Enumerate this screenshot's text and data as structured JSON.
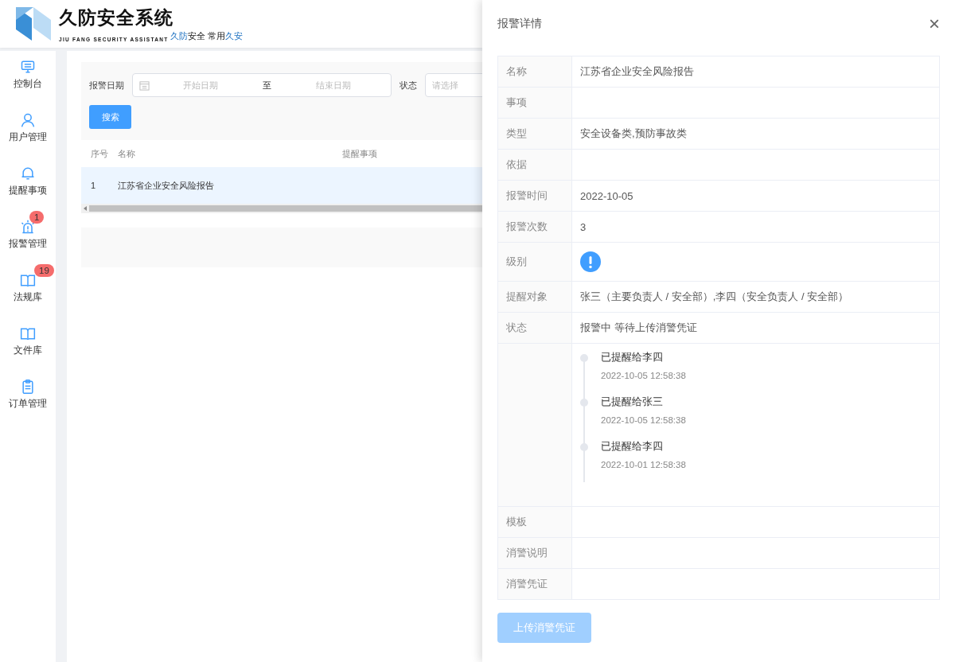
{
  "brand": {
    "title": "久防安全系统",
    "subtitle": "JIU FANG SECURITY ASSISTANT",
    "slogan": [
      {
        "text": "久防",
        "accent": true
      },
      {
        "text": "安全 ",
        "accent": false
      },
      {
        "text": "常用",
        "accent": false
      },
      {
        "text": "久安",
        "accent": true
      }
    ]
  },
  "sidebar": {
    "items": [
      {
        "label": "控制台"
      },
      {
        "label": "用户管理"
      },
      {
        "label": "提醒事项"
      },
      {
        "label": "报警管理",
        "badge": "1"
      },
      {
        "label": "法规库",
        "badge": "19"
      },
      {
        "label": "文件库"
      },
      {
        "label": "订单管理"
      }
    ]
  },
  "filters": {
    "date_label": "报警日期",
    "start_placeholder": "开始日期",
    "separator": "至",
    "end_placeholder": "结束日期",
    "status_label": "状态",
    "status_placeholder": "请选择",
    "search_button": "搜索"
  },
  "table": {
    "columns": [
      "序号",
      "名称",
      "提醒事项"
    ],
    "rows": [
      {
        "cells": [
          "1",
          "江苏省企业安全风险报告"
        ],
        "selected": true
      }
    ]
  },
  "drawer": {
    "title": "报警详情",
    "close": "×",
    "rows": [
      {
        "kind": "text",
        "label": "名称",
        "value": "江苏省企业安全风险报告"
      },
      {
        "kind": "text",
        "label": "事项"
      },
      {
        "kind": "text",
        "label": "类型",
        "value": "安全设备类,预防事故类"
      },
      {
        "kind": "text",
        "label": "依据"
      },
      {
        "kind": "text",
        "label": "报警时间",
        "value": "2022-10-05"
      },
      {
        "kind": "text",
        "label": "报警次数",
        "value": "3"
      },
      {
        "kind": "icon",
        "label": "级别"
      },
      {
        "kind": "text",
        "label": "提醒对象",
        "value": "张三（主要负责人 / 安全部）,李四（安全负责人 / 安全部）"
      },
      {
        "kind": "text",
        "label": "状态",
        "value": "报警中 等待上传消警凭证"
      },
      {
        "kind": "timeline",
        "events": [
          {
            "title": "已提醒给李四",
            "time": "2022-10-05 12:58:38"
          },
          {
            "title": "已提醒给张三",
            "time": "2022-10-05 12:58:38"
          },
          {
            "title": "已提醒给李四",
            "time": "2022-10-01 12:58:38"
          }
        ]
      },
      {
        "kind": "text",
        "label": "模板"
      },
      {
        "kind": "text",
        "label": "消警说明"
      },
      {
        "kind": "text",
        "label": "消警凭证"
      }
    ],
    "upload_button": {
      "label": "上传消警凭证",
      "disabled": true
    }
  }
}
